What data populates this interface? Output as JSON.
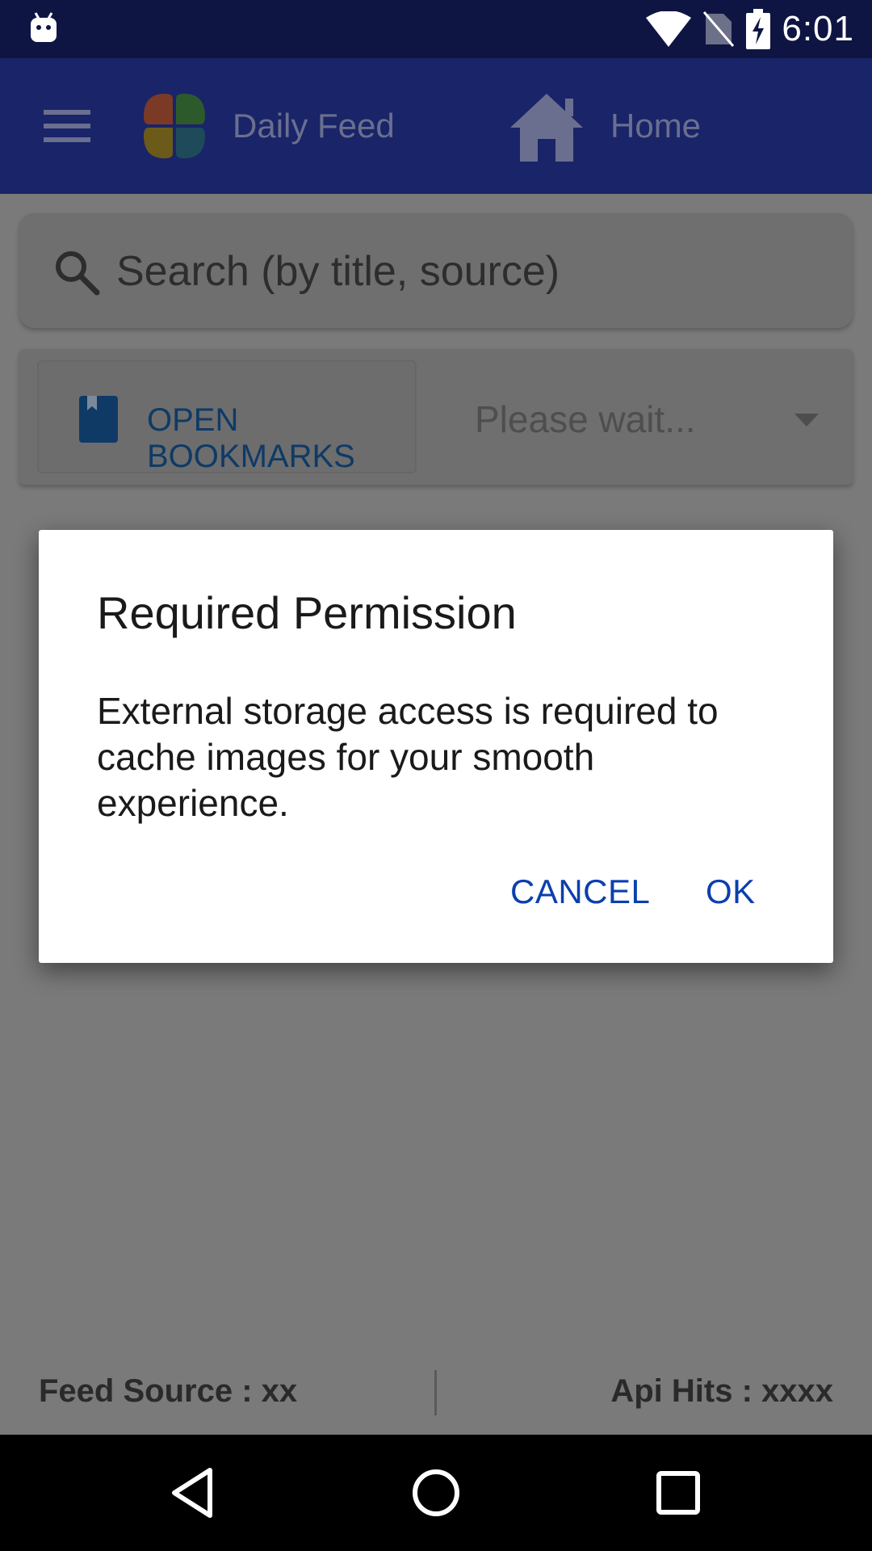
{
  "status_bar": {
    "time": "6:01",
    "icons": [
      "android-notification-icon",
      "wifi-icon",
      "no-sim-icon",
      "battery-charging-icon"
    ]
  },
  "app_bar": {
    "title": "Daily Feed",
    "home_label": "Home",
    "icons": [
      "menu-icon",
      "app-logo-icon",
      "home-icon"
    ]
  },
  "search": {
    "placeholder": "Search (by title, source)"
  },
  "toolbar": {
    "bookmarks_label": "OPEN BOOKMARKS",
    "dropdown_value": "Please wait..."
  },
  "footer": {
    "feed_source": "Feed Source : xx",
    "api_hits": "Api Hits : xxxx"
  },
  "dialog": {
    "title": "Required Permission",
    "message": "External storage access is required to cache images for your smooth experience.",
    "cancel_label": "CANCEL",
    "ok_label": "OK"
  },
  "colors": {
    "status_bar": "#0f1543",
    "app_bar": "#1a2468",
    "scrim_background": "#7a7a7a",
    "dialog_button": "#0b3fae",
    "bookmark_accent": "#0f3a66"
  }
}
